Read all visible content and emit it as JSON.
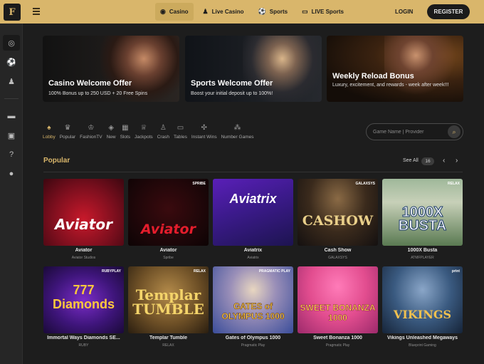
{
  "header": {
    "logo_letter": "F",
    "nav": [
      {
        "label": "Casino",
        "icon": "casino-chip-icon",
        "active": true
      },
      {
        "label": "Live Casino",
        "icon": "live-dealer-icon",
        "active": false
      },
      {
        "label": "Sports",
        "icon": "soccer-ball-icon",
        "active": false
      },
      {
        "label": "LIVE Sports",
        "icon": "tv-icon",
        "active": false
      }
    ],
    "login": "LOGIN",
    "register": "REGISTER"
  },
  "banners": [
    {
      "title": "Casino Welcome Offer",
      "subtitle": "100% Bonus up to 250 USD + 20 Free Spins"
    },
    {
      "title": "Sports Welcome Offer",
      "subtitle": "Boost your initial deposit up to 100%!"
    },
    {
      "title": "Weekly Reload Bonus",
      "subtitle": "Luxury, excitement, and rewards - week after week!!!"
    }
  ],
  "categories": [
    "Lobby",
    "Popular",
    "FashionTV",
    "New",
    "Slots",
    "Jackpots",
    "Crash",
    "Tables",
    "Instant Wins",
    "Number Games"
  ],
  "search": {
    "placeholder": "Game Name | Provider"
  },
  "section": {
    "title": "Popular",
    "see_all": "See All",
    "count": "16"
  },
  "games": [
    {
      "name": "Aviator",
      "provider": "Aviator Studios",
      "art": "Aviator",
      "badge": ""
    },
    {
      "name": "Aviator",
      "provider": "Spribe",
      "art": "Aviator",
      "badge": "SPRIBE"
    },
    {
      "name": "Aviatrix",
      "provider": "Aviatrix",
      "art": "Aviatrix",
      "badge": ""
    },
    {
      "name": "Cash Show",
      "provider": "GALAXSYS",
      "art": "CASHOW",
      "badge": "GALAXSYS"
    },
    {
      "name": "1000X Busta",
      "provider": "ATMFPLAYER",
      "art": "1000X BUSTA",
      "badge": "RELAX"
    },
    {
      "name": "Immortal Ways Diamonds SE...",
      "provider": "RUBY",
      "art": "777 Diamonds",
      "badge": "RUBYPLAY"
    },
    {
      "name": "Templar Tumble",
      "provider": "RELAX",
      "art": "Templar TUMBLE",
      "badge": "RELAX"
    },
    {
      "name": "Gates of Olympus 1000",
      "provider": "Pragmatic Play",
      "art": "GATES of OLYMPUS 1000",
      "badge": "PRAGMATIC PLAY"
    },
    {
      "name": "Sweet Bonanza 1000",
      "provider": "Pragmatic Play",
      "art": "SWEET BONANZA 1000",
      "badge": ""
    },
    {
      "name": "Vikings Unleashed Megaways",
      "provider": "Blueprint Gaming",
      "art": "VIKINGS",
      "badge": "print"
    }
  ]
}
